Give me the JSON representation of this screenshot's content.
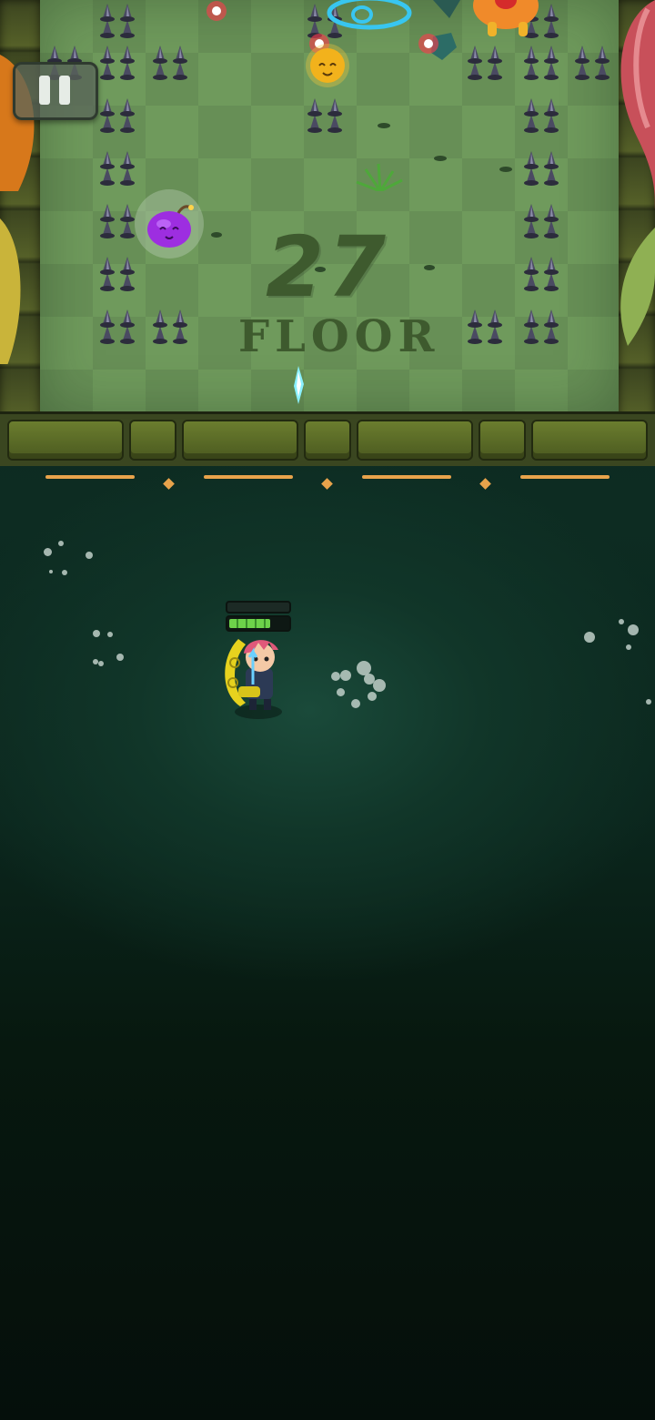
{
  "floor": {
    "number": "27",
    "label": "FLOOR"
  },
  "pause": {
    "icon": "pause-icon"
  },
  "player": {
    "hp_fraction": 0.7,
    "hp_segments": 4
  },
  "colors": {
    "board": "#6f9a5c",
    "wall": "#4b5a20",
    "gate": "#e8a34b",
    "hp": "#6dd34a",
    "background": "#0b261d"
  }
}
